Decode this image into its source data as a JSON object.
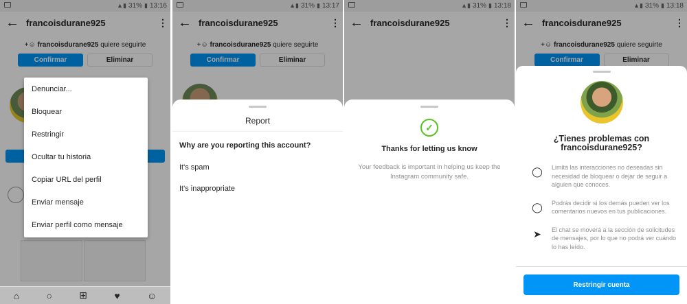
{
  "status": {
    "battery1": "31%",
    "time1": "13:16",
    "battery2": "31%",
    "time2": "13:17",
    "battery3": "31%",
    "time3": "13:18",
    "battery4": "31%",
    "time4": "13:18"
  },
  "profile": {
    "username": "francoisdurane925",
    "request_user": "francoisdurane925",
    "request_text": " quiere seguirte",
    "confirm_label": "Confirmar",
    "delete_label": "Eliminar"
  },
  "menu": {
    "items": [
      "Denunciar...",
      "Bloquear",
      "Restringir",
      "Ocultar tu historia",
      "Copiar URL del perfil",
      "Enviar mensaje",
      "Enviar perfil como mensaje"
    ]
  },
  "report": {
    "title": "Report",
    "question": "Why are you reporting this account?",
    "options": [
      "It's spam",
      "It's inappropriate"
    ]
  },
  "thanks": {
    "title": "Thanks for letting us know",
    "text": "Your feedback is important in helping us keep the Instagram community safe."
  },
  "restrict": {
    "title": "¿Tienes problemas con francoisdurane925?",
    "items": [
      {
        "icon": "shield-icon",
        "text": "Limita las interacciones no deseadas sin necesidad de bloquear o dejar de seguir a alguien que conoces."
      },
      {
        "icon": "comment-icon",
        "text": "Podrás decidir si los demás pueden ver los comentarios nuevos en tus publicaciones."
      },
      {
        "icon": "send-icon",
        "text": "El chat se moverá a la sección de solicitudes de mensajes, por lo que no podrá ver cuándo lo has leído."
      }
    ],
    "button_label": "Restringir cuenta"
  },
  "colors": {
    "accent": "#0095f6",
    "success": "#58c322"
  }
}
